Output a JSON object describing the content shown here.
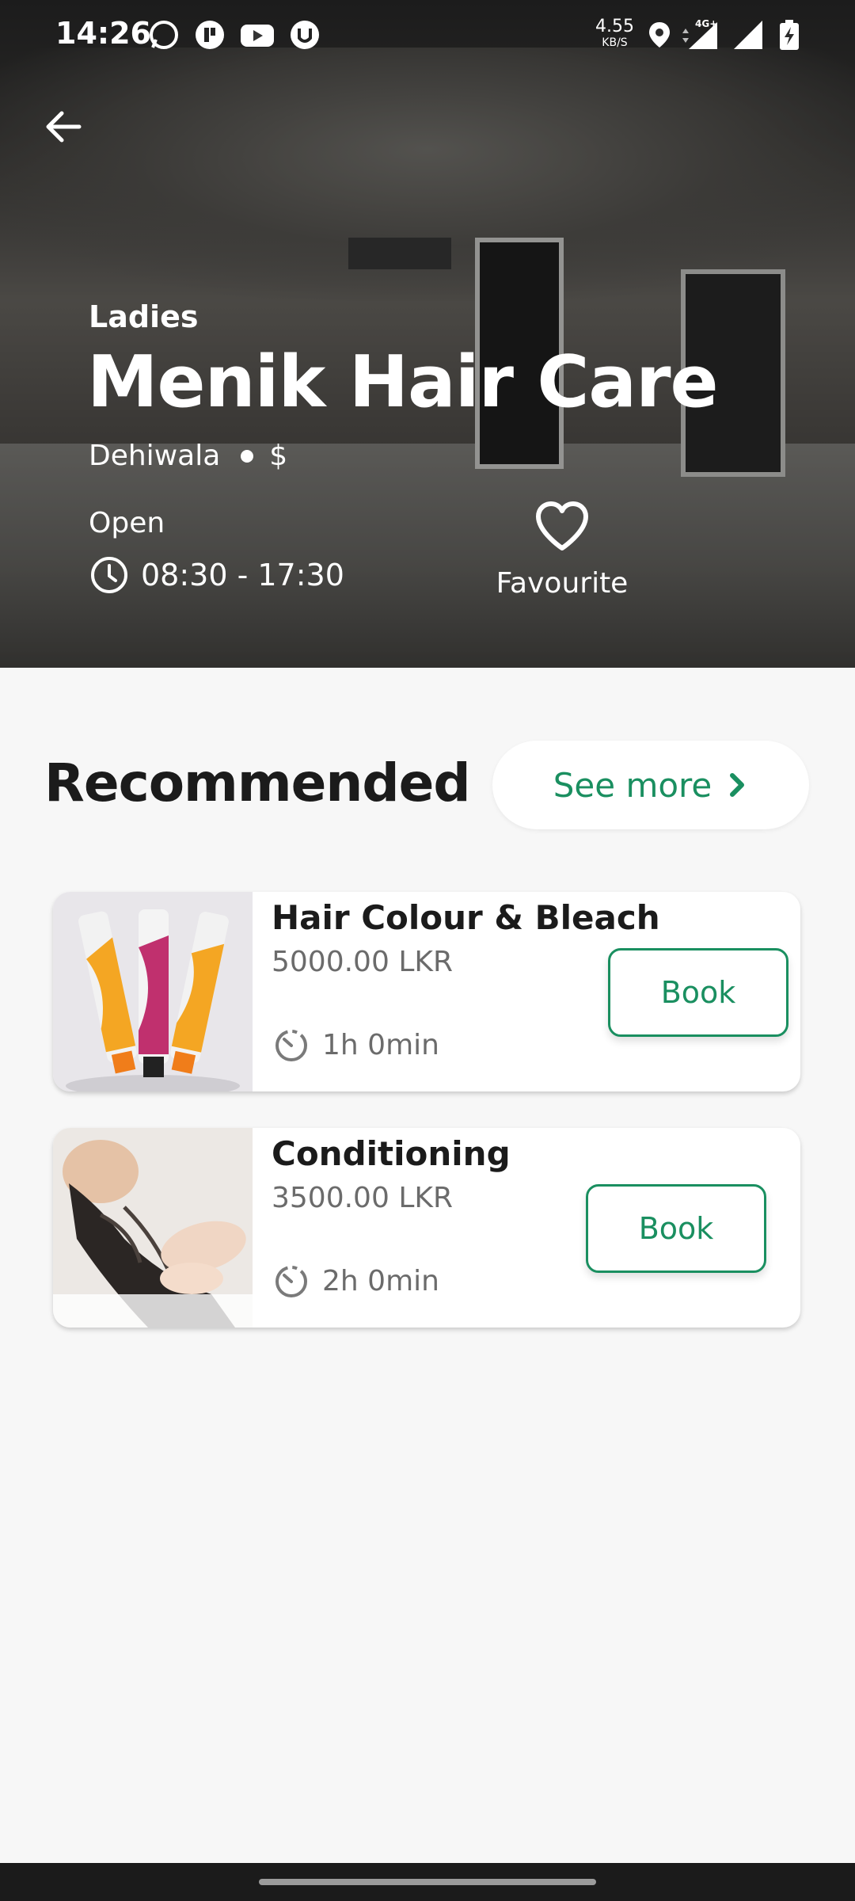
{
  "status_bar": {
    "time": "14:26",
    "network_speed": "4.55",
    "network_unit": "KB/S",
    "network_type": "4G+",
    "left_icons": [
      "whatsapp-icon",
      "app-icon",
      "youtube-icon",
      "app-icon-2"
    ],
    "right_icons": [
      "location-icon",
      "data-arrows-icon",
      "signal-icon",
      "signal-icon-2",
      "battery-charging-icon"
    ]
  },
  "salon": {
    "category": "Ladies",
    "name": "Menik Hair Care",
    "location": "Dehiwala",
    "price_level": "$",
    "status": "Open",
    "hours": "08:30 - 17:30",
    "favourite_label": "Favourite"
  },
  "recommended": {
    "title": "Recommended",
    "see_more_label": "See more",
    "services": [
      {
        "name": "Hair Colour & Bleach",
        "price": "5000.00 LKR",
        "duration": "1h 0min",
        "book_label": "Book",
        "image": "hair-colour-tubes"
      },
      {
        "name": "Conditioning",
        "price": "3500.00 LKR",
        "duration": "2h 0min",
        "book_label": "Book",
        "image": "hair-wash"
      }
    ]
  },
  "colors": {
    "accent": "#1a8f60",
    "background": "#f7f7f7",
    "card": "#ffffff",
    "muted_text": "#6b6b6b"
  }
}
